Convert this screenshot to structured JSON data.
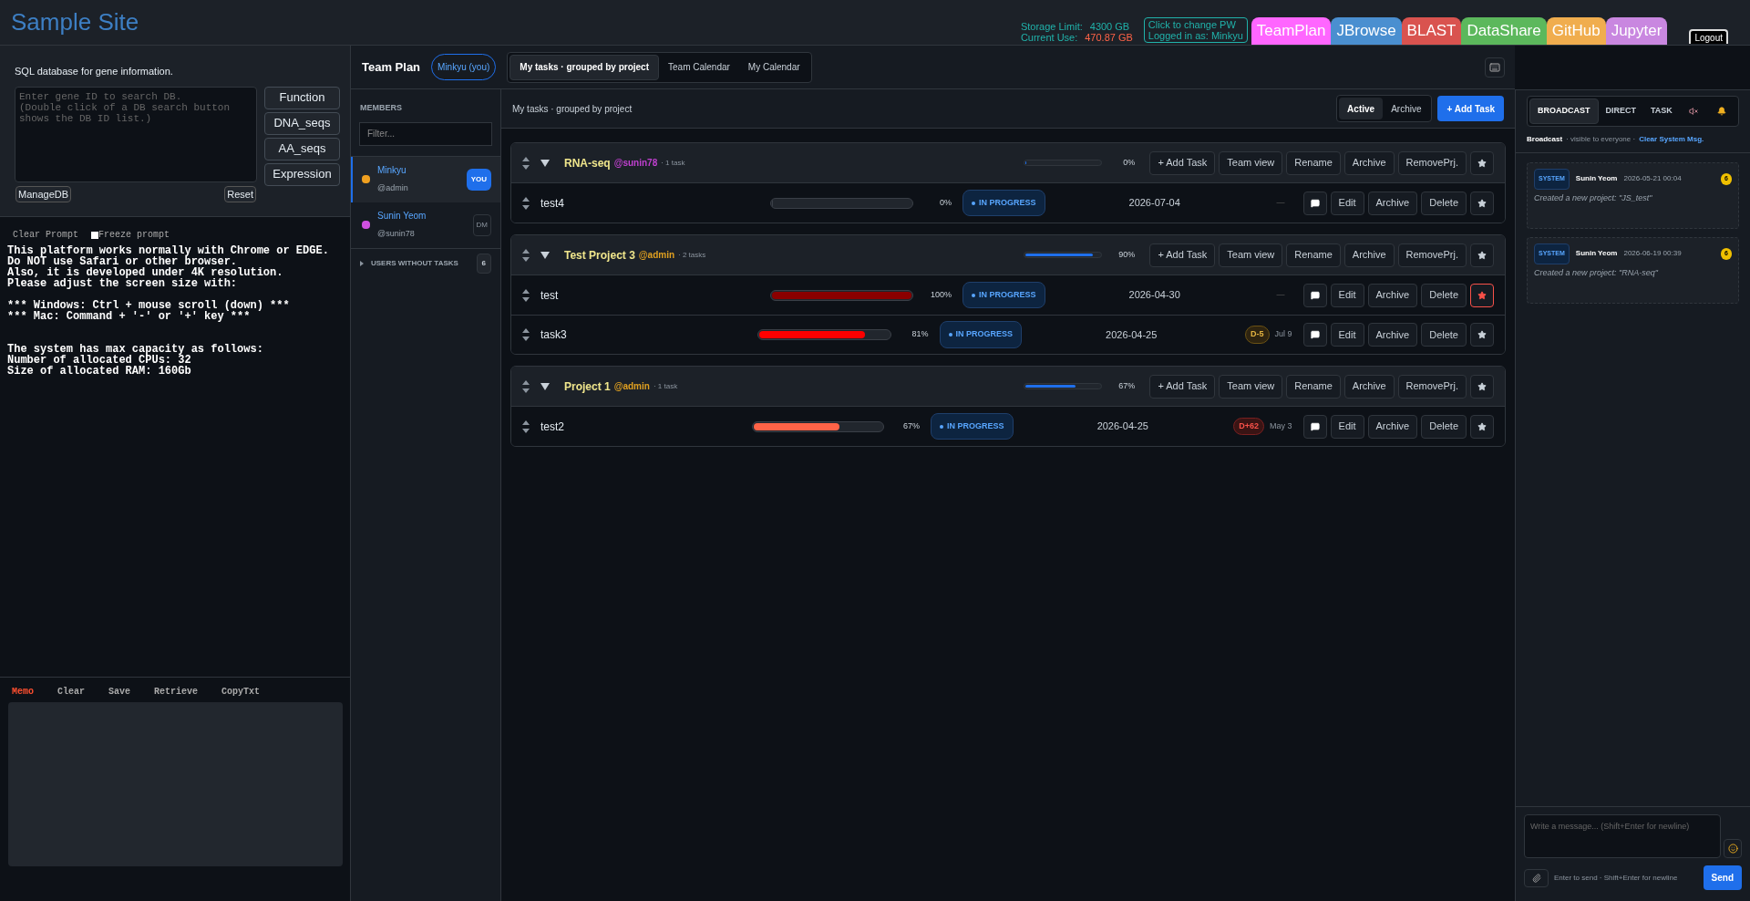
{
  "site_title": "Sample Site",
  "storage": {
    "limit_label": "Storage Limit:",
    "limit_value": "4300 GB",
    "use_label": "Current Use:",
    "use_value": "470.87 GB"
  },
  "account": {
    "line1": "Click to change PW",
    "line2": "Logged in as: Minkyu"
  },
  "app_tabs": [
    {
      "label": "TeamPlan",
      "color": "#ff66ff"
    },
    {
      "label": "JBrowse",
      "color": "#4a8fd0"
    },
    {
      "label": "BLAST",
      "color": "#d9534f"
    },
    {
      "label": "DataShare",
      "color": "#5cb85c"
    },
    {
      "label": "GitHub",
      "color": "#f0ad4e"
    },
    {
      "label": "Jupyter",
      "color": "#c987e0"
    }
  ],
  "logout": "Logout",
  "sql": {
    "title": "SQL database for gene information.",
    "placeholder": "Enter gene ID to search DB.\n(Double click of a DB search button\nshows the DB ID list.)",
    "buttons": [
      "Function",
      "DNA_seqs",
      "AA_seqs",
      "Expression"
    ],
    "manage": "ManageDB",
    "reset": "Reset"
  },
  "prompt": {
    "clear": "Clear Prompt",
    "freeze_label": "Freeze prompt",
    "freeze_checked": false,
    "text": "This platform works normally with Chrome or EDGE.\nDo NOT use Safari or other browser.\nAlso, it is developed under 4K resolution.\nPlease adjust the screen size with:\n\n*** Windows: Ctrl + mouse scroll (down) ***\n*** Mac: Command + '-' or '+' key ***\n\n\nThe system has max capacity as follows:\nNumber of allocated CPUs: 32\nSize of allocated RAM: 160Gb"
  },
  "memo": {
    "title": "Memo",
    "actions": [
      "Clear",
      "Save",
      "Retrieve",
      "CopyTxt"
    ]
  },
  "team_plan": {
    "title": "Team Plan",
    "user_chip": "Minkyu (you)",
    "views": [
      {
        "label": "My tasks · grouped by project",
        "selected": true
      },
      {
        "label": "Team Calendar",
        "selected": false
      },
      {
        "label": "My Calendar",
        "selected": false
      }
    ]
  },
  "members": {
    "heading": "MEMBERS",
    "filter_placeholder": "Filter...",
    "items": [
      {
        "name": "Minkyu",
        "handle": "@admin",
        "color": "#f0a020",
        "selected": true,
        "badge": {
          "kind": "you",
          "label": "YOU"
        }
      },
      {
        "name": "Sunin Yeom",
        "handle": "@sunin78",
        "color": "#d050e0",
        "selected": false,
        "badge": {
          "kind": "dm",
          "label": "DM"
        }
      }
    ],
    "without_tasks": {
      "label": "USERS WITHOUT TASKS",
      "count": "6"
    }
  },
  "tasks": {
    "heading": "My tasks · grouped by project",
    "filters": [
      {
        "label": "Active",
        "selected": true
      },
      {
        "label": "Archive",
        "selected": false
      }
    ],
    "add_task": "+ Add Task",
    "projects": [
      {
        "name": "RNA-seq",
        "owner": {
          "handle": "@sunin78",
          "color": "#c040d0"
        },
        "count": "· 1 task",
        "level": 0,
        "percent": "0%",
        "starred": false,
        "actions": [
          "+ Add Task",
          "Team view",
          "Rename",
          "Archive",
          "RemovePrj."
        ],
        "tasks": [
          {
            "name": "test4",
            "level": 0,
            "color": "#3a3f47",
            "percent": "0%",
            "status": "IN PROGRESS",
            "date": "2026-07-04",
            "due": {
              "kind": "none",
              "label": "—"
            },
            "actions": [
              "Edit",
              "Archive",
              "Delete"
            ],
            "starred": false
          }
        ]
      },
      {
        "name": "Test Project 3",
        "owner": {
          "handle": "@admin",
          "color": "#e0a020"
        },
        "count": "· 2 tasks",
        "level": 0.9,
        "percent": "90%",
        "starred": false,
        "actions": [
          "+ Add Task",
          "Team view",
          "Rename",
          "Archive",
          "RemovePrj."
        ],
        "tasks": [
          {
            "name": "test",
            "level": 1,
            "color": "#8b0000",
            "percent": "100%",
            "status": "IN PROGRESS",
            "date": "2026-04-30",
            "due": {
              "kind": "none",
              "label": "—"
            },
            "actions": [
              "Edit",
              "Archive",
              "Delete"
            ],
            "starred": true
          },
          {
            "name": "task3",
            "level": 0.81,
            "color": "#ff0000",
            "percent": "81%",
            "status": "IN PROGRESS",
            "date": "2026-04-25",
            "due": {
              "kind": "soon",
              "label": "D-5",
              "date": "Jul 9"
            },
            "actions": [
              "Edit",
              "Archive",
              "Delete"
            ],
            "starred": false
          }
        ]
      },
      {
        "name": "Project 1",
        "owner": {
          "handle": "@admin",
          "color": "#e0a020"
        },
        "count": "· 1 task",
        "level": 0.67,
        "percent": "67%",
        "starred": false,
        "actions": [
          "+ Add Task",
          "Team view",
          "Rename",
          "Archive",
          "RemovePrj."
        ],
        "tasks": [
          {
            "name": "test2",
            "level": 0.67,
            "color": "#ff6347",
            "percent": "67%",
            "status": "IN PROGRESS",
            "date": "2026-04-25",
            "due": {
              "kind": "overdue",
              "label": "D+62",
              "date": "May 3"
            },
            "actions": [
              "Edit",
              "Archive",
              "Delete"
            ],
            "starred": false
          }
        ]
      }
    ]
  },
  "chat": {
    "tabs": [
      {
        "label": "BROADCAST",
        "kind": "text",
        "selected": true
      },
      {
        "label": "DIRECT",
        "kind": "text",
        "selected": false
      },
      {
        "label": "TASK",
        "kind": "text",
        "selected": false
      },
      {
        "kind": "mute",
        "selected": false
      },
      {
        "kind": "bell",
        "selected": false
      }
    ],
    "scope": "Broadcast",
    "scope_note": "· visible to everyone ·",
    "clear": "Clear System Msg.",
    "messages": [
      {
        "tag": "SYSTEM",
        "author": "Sunin Yeom",
        "time": "2026-05-21 00:04",
        "count": "6",
        "text": "Created a new project: \"JS_test\""
      },
      {
        "tag": "SYSTEM",
        "author": "Sunin Yeom",
        "time": "2026-06-19 00:39",
        "count": "6",
        "text": "Created a new project: \"RNA-seq\""
      }
    ],
    "input_placeholder": "Write a message... (Shift+Enter for newline)",
    "hint": "Enter to send · Shift+Enter for newline",
    "send": "Send"
  }
}
